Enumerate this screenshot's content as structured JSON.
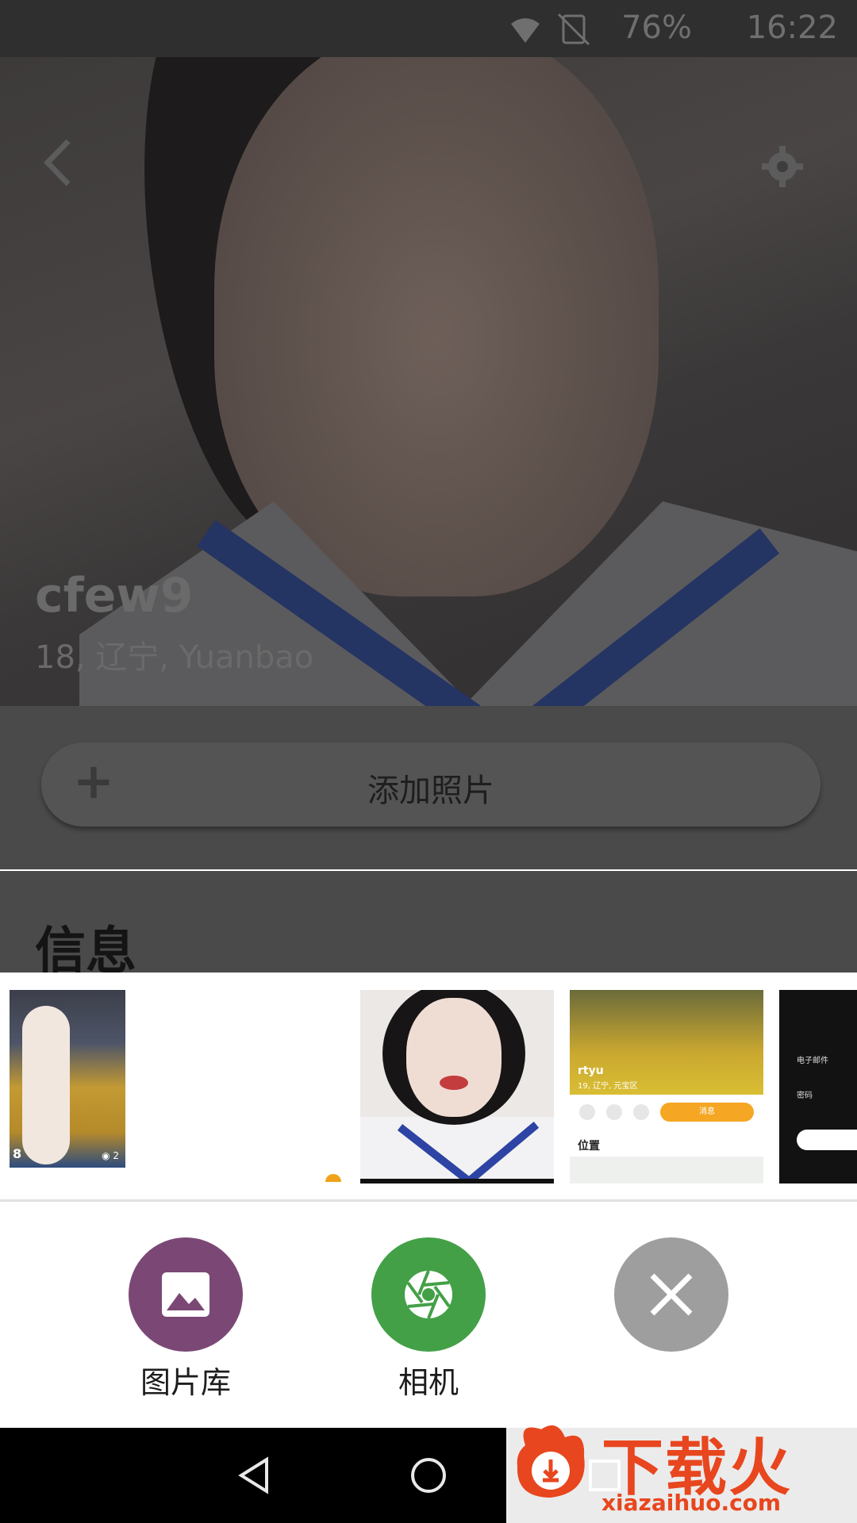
{
  "status_bar": {
    "battery": "76%",
    "time": "16:22"
  },
  "profile": {
    "name": "cfew9",
    "subtitle": "18, 辽宁, Yuanbao",
    "add_photo_label": "添加照片",
    "info_heading": "信息"
  },
  "thumbnails": {
    "t1_count": "8",
    "t1_photos": "2",
    "t3_name": "rtyu",
    "t3_sub": "19, 辽宁, 元宝区",
    "t3_button": "消息",
    "t3_section": "位置",
    "t4_line1": "电子邮件",
    "t4_line2": "密码"
  },
  "actions": {
    "gallery_label": "图片库",
    "camera_label": "相机"
  },
  "watermark": {
    "brand": "下载火",
    "url": "xiazaihuo.com"
  },
  "colors": {
    "gallery": "#7b4876",
    "camera": "#43a047",
    "close": "#9e9e9e",
    "accent": "#f5a623"
  }
}
